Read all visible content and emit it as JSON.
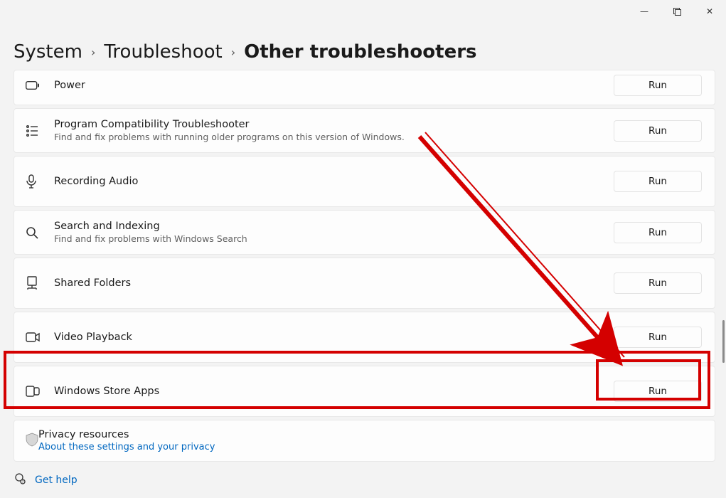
{
  "window": {
    "minimize": "—",
    "maximize": "◻",
    "close": "✕"
  },
  "breadcrumb": {
    "root": "System",
    "mid": "Troubleshoot",
    "current": "Other troubleshooters",
    "sep": "›"
  },
  "items": [
    {
      "key": "power",
      "title": "Power",
      "desc": "",
      "run": "Run"
    },
    {
      "key": "program-compat",
      "title": "Program Compatibility Troubleshooter",
      "desc": "Find and fix problems with running older programs on this version of Windows.",
      "run": "Run"
    },
    {
      "key": "recording-audio",
      "title": "Recording Audio",
      "desc": "",
      "run": "Run"
    },
    {
      "key": "search-indexing",
      "title": "Search and Indexing",
      "desc": "Find and fix problems with Windows Search",
      "run": "Run"
    },
    {
      "key": "shared-folders",
      "title": "Shared Folders",
      "desc": "",
      "run": "Run"
    },
    {
      "key": "video-playback",
      "title": "Video Playback",
      "desc": "",
      "run": "Run"
    },
    {
      "key": "windows-store-apps",
      "title": "Windows Store Apps",
      "desc": "",
      "run": "Run"
    }
  ],
  "privacy": {
    "title": "Privacy resources",
    "link": "About these settings and your privacy"
  },
  "help": {
    "label": "Get help"
  }
}
